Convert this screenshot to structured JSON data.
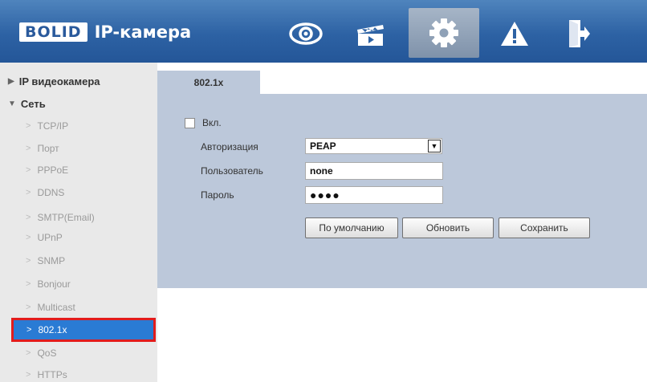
{
  "header": {
    "logo_box": "BOLID",
    "logo_text": "IP-камера",
    "nav": [
      "live-view-eye-icon",
      "playback-clapper-icon",
      "settings-gear-icon",
      "alarm-warning-icon",
      "logout-exit-icon"
    ],
    "active_nav": "settings-gear-icon",
    "colors": {
      "bar": "#2d62a4",
      "active": "#8fa1b7"
    }
  },
  "sidebar": {
    "top_items": [
      {
        "label": "IP видеокамера",
        "expanded": false
      },
      {
        "label": "Сеть",
        "expanded": true
      }
    ],
    "items": [
      "TCP/IP",
      "Порт",
      "PPPoE",
      "DDNS",
      "SMTP(Email)",
      "UPnP",
      "SNMP",
      "Bonjour",
      "Multicast",
      "802.1x",
      "QoS",
      "HTTPs"
    ],
    "active_item": "802.1x",
    "colors": {
      "active_bg": "#2a7bd4",
      "highlight_border": "#e21c1c"
    }
  },
  "main": {
    "tab": "802.1x",
    "enable_label": "Вкл.",
    "enable_checked": false,
    "auth_label": "Авторизация",
    "auth_value": "PEAP",
    "user_label": "Пользователь",
    "user_value": "none",
    "password_label": "Пароль",
    "password_value": "●●●●",
    "buttons": {
      "default": "По умолчанию",
      "refresh": "Обновить",
      "save": "Сохранить"
    },
    "colors": {
      "panel": "#bcc8da"
    }
  }
}
